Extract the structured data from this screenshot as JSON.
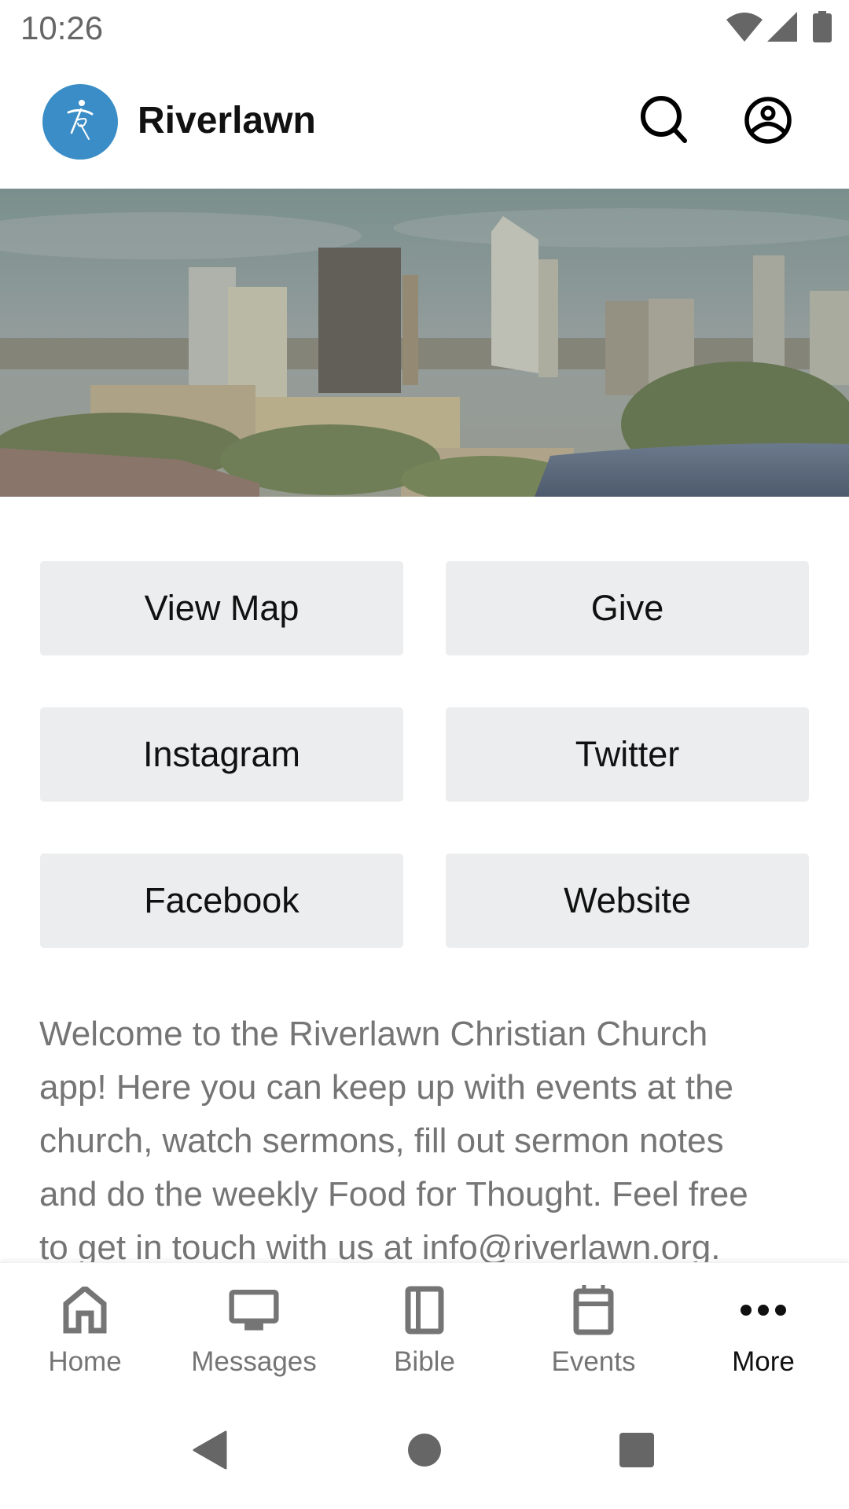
{
  "status_bar": {
    "time": "10:26",
    "icons": [
      "wifi-icon",
      "cellular-signal-icon",
      "battery-icon"
    ]
  },
  "header": {
    "app_name": "Riverlawn",
    "logo_icon": "riverlawn-runner-logo",
    "actions": [
      "search-icon",
      "account-circle-icon"
    ],
    "brand_color": "#3a8dc6"
  },
  "hero": {
    "description": "City skyline with river"
  },
  "link_buttons": [
    {
      "label": "View Map"
    },
    {
      "label": "Give"
    },
    {
      "label": "Instagram"
    },
    {
      "label": "Twitter"
    },
    {
      "label": "Facebook"
    },
    {
      "label": "Website"
    }
  ],
  "welcome": {
    "lines": [
      "Welcome to the Riverlawn Christian Church",
      "app! Here you can keep up with events at the",
      "church, watch sermons, fill out sermon notes",
      "and do the weekly Food for Thought. Feel free",
      "to get in touch with us at info@riverlawn.org."
    ]
  },
  "bottom_nav": {
    "items": [
      {
        "label": "Home",
        "icon": "home-icon"
      },
      {
        "label": "Messages",
        "icon": "monitor-icon"
      },
      {
        "label": "Bible",
        "icon": "book-icon"
      },
      {
        "label": "Events",
        "icon": "calendar-icon"
      },
      {
        "label": "More",
        "icon": "more-horizontal-icon",
        "active": true
      }
    ],
    "inactive_color": "#757575",
    "active_color": "#111111"
  },
  "system_nav": {
    "buttons": [
      "back",
      "home",
      "recents"
    ]
  }
}
